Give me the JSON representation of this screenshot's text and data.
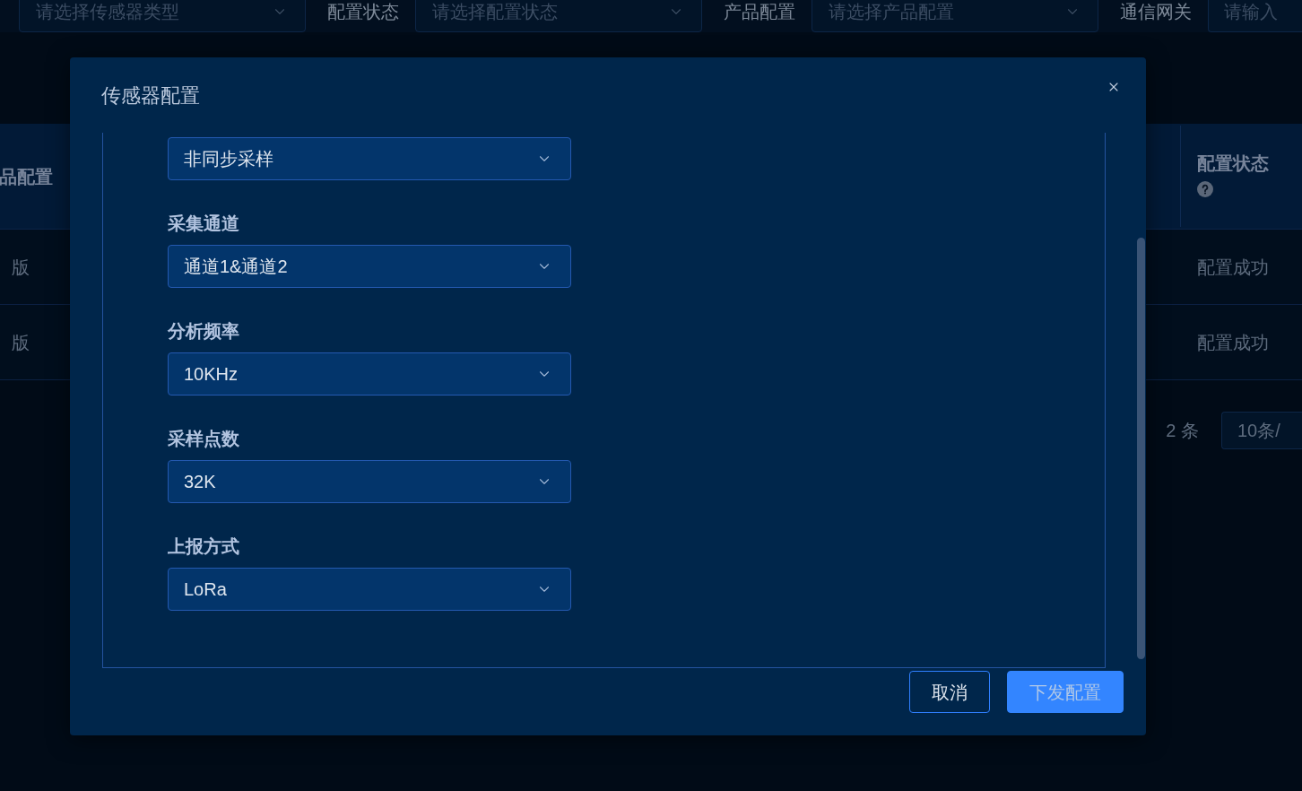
{
  "background": {
    "filters": [
      {
        "kind": "select",
        "placeholder": "请选择传感器类型"
      },
      {
        "kind": "select",
        "label": "配置状态",
        "placeholder": "请选择配置状态"
      },
      {
        "kind": "select",
        "label": "产品配置",
        "placeholder": "请选择产品配置"
      },
      {
        "kind": "input",
        "label": "通信网关",
        "placeholder": "请输入"
      }
    ],
    "table": {
      "columns": [
        {
          "label": "品配置",
          "help": false
        },
        {
          "label": "配置状态",
          "help": true
        }
      ],
      "rows": [
        {
          "cells": [
            "版",
            "配置成功"
          ]
        },
        {
          "cells": [
            "版",
            "配置成功"
          ]
        }
      ]
    },
    "pagination": {
      "total": "2 条",
      "page_size": "10条/"
    }
  },
  "dialog": {
    "title": "传感器配置",
    "fields": [
      {
        "value": "非同步采样"
      },
      {
        "label": "采集通道",
        "value": "通道1&通道2"
      },
      {
        "label": "分析频率",
        "value": "10KHz"
      },
      {
        "label": "采样点数",
        "value": "32K"
      },
      {
        "label": "上报方式",
        "value": "LoRa"
      }
    ],
    "buttons": [
      {
        "label": "取消",
        "kind": "secondary"
      },
      {
        "label": "下发配置",
        "kind": "primary"
      }
    ]
  }
}
